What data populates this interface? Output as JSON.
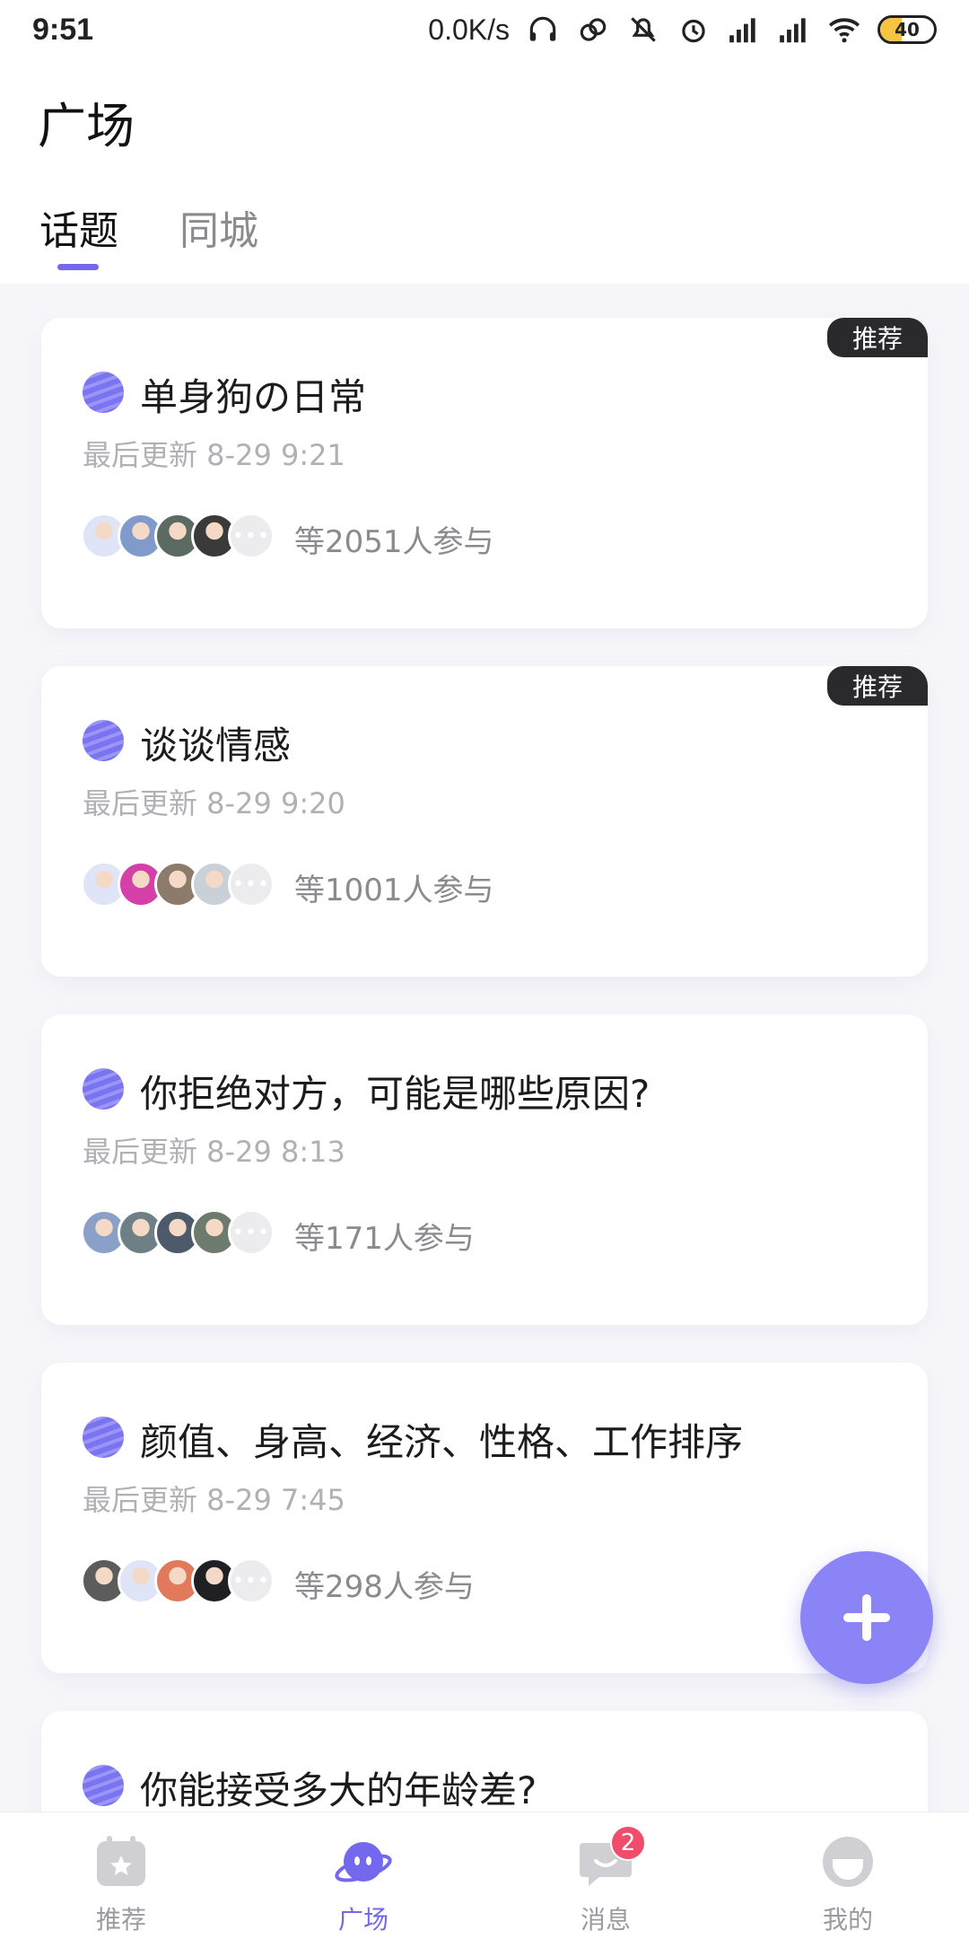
{
  "status_bar": {
    "time": "9:51",
    "speed": "0.0K/s",
    "battery": "40",
    "battery_level": 0.4
  },
  "header": {
    "title": "广场",
    "tabs": [
      {
        "label": "话题",
        "active": true
      },
      {
        "label": "同城",
        "active": false
      }
    ]
  },
  "topics": [
    {
      "badge": "推荐",
      "title": "单身狗の日常",
      "updated": "最后更新 8-29 9:21",
      "participants": "等2051人参与",
      "avatar_colors": [
        "#dfe4f7",
        "#7f9acb",
        "#5b6b62",
        "#3a3a3a"
      ]
    },
    {
      "badge": "推荐",
      "title": "谈谈情感",
      "updated": "最后更新 8-29 9:20",
      "participants": "等1001人参与",
      "avatar_colors": [
        "#dfe4f7",
        "#d43fa8",
        "#8c7a6a",
        "#c9d0d8"
      ]
    },
    {
      "title": "你拒绝对方，可能是哪些原因?",
      "updated": "最后更新 8-29 8:13",
      "participants": "等171人参与",
      "avatar_colors": [
        "#8aa0c8",
        "#6f7f86",
        "#4c5a6a",
        "#6d7b6e"
      ]
    },
    {
      "title": "颜值、身高、经济、性格、工作排序",
      "updated": "最后更新 8-29 7:45",
      "participants": "等298人参与",
      "avatar_colors": [
        "#5c5c5c",
        "#dfe4f7",
        "#e07a5a",
        "#1f1f24"
      ]
    },
    {
      "title": "你能接受多大的年龄差?"
    }
  ],
  "fab": {
    "icon": "plus-icon"
  },
  "bottom_nav": [
    {
      "label": "推荐",
      "icon": "calendar-star-icon",
      "active": false
    },
    {
      "label": "广场",
      "icon": "planet-face-icon",
      "active": true
    },
    {
      "label": "消息",
      "icon": "chat-bubble-icon",
      "active": false,
      "badge": "2"
    },
    {
      "label": "我的",
      "icon": "profile-face-icon",
      "active": false
    }
  ],
  "colors": {
    "accent": "#7468ee",
    "fab": "#8b84f6",
    "badge_bg": "#2a2a2c",
    "notification": "#ef4d6b"
  }
}
